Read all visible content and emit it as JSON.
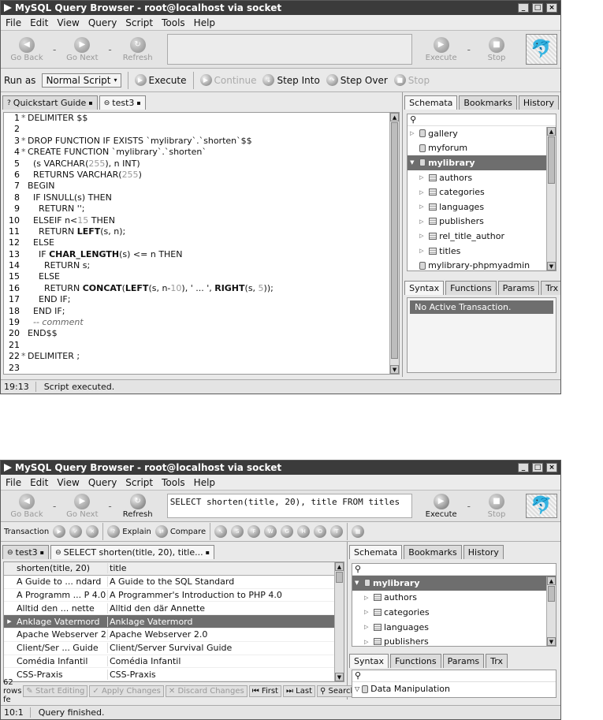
{
  "window1": {
    "title": "MySQL Query Browser - root@localhost via socket",
    "menu": [
      "File",
      "Edit",
      "View",
      "Query",
      "Script",
      "Tools",
      "Help"
    ],
    "nav": {
      "back": "Go Back",
      "next": "Go Next",
      "refresh": "Refresh"
    },
    "exec": {
      "execute": "Execute",
      "stop": "Stop"
    },
    "script_bar": {
      "run_as_label": "Run as",
      "run_as_value": "Normal Script",
      "execute": "Execute",
      "continue": "Continue",
      "step_into": "Step Into",
      "step_over": "Step Over",
      "stop": "Stop"
    },
    "tabs": [
      "Quickstart Guide",
      "test3"
    ],
    "code": [
      {
        "n": "1",
        "m": "*",
        "html": "DELIMITER $$"
      },
      {
        "n": "2",
        "m": "",
        "html": ""
      },
      {
        "n": "3",
        "m": "*",
        "html": "DROP FUNCTION IF EXISTS `mylibrary`.`shorten`$$"
      },
      {
        "n": "4",
        "m": "*",
        "html": "CREATE FUNCTION `mylibrary`.`shorten`"
      },
      {
        "n": "5",
        "m": "",
        "html": "  (s VARCHAR(<span class=\"num\">255</span>), n INT)"
      },
      {
        "n": "6",
        "m": "",
        "html": "  RETURNS VARCHAR(<span class=\"num\">255</span>)"
      },
      {
        "n": "7",
        "m": "",
        "html": "BEGIN"
      },
      {
        "n": "8",
        "m": "",
        "html": "  IF ISNULL(s) THEN"
      },
      {
        "n": "9",
        "m": "",
        "html": "    RETURN '';"
      },
      {
        "n": "10",
        "m": "",
        "html": "  ELSEIF n&lt;<span class=\"num\">15</span> THEN"
      },
      {
        "n": "11",
        "m": "",
        "html": "    RETURN <b>LEFT</b>(s, n);"
      },
      {
        "n": "12",
        "m": "",
        "html": "  ELSE"
      },
      {
        "n": "13",
        "m": "",
        "html": "    IF <b>CHAR_LENGTH</b>(s) &lt;= n THEN"
      },
      {
        "n": "14",
        "m": "",
        "html": "      RETURN s;"
      },
      {
        "n": "15",
        "m": "",
        "html": "    ELSE"
      },
      {
        "n": "16",
        "m": "",
        "html": "      RETURN <b>CONCAT</b>(<b>LEFT</b>(s, n-<span class=\"num\">10</span>), ' ... ', <b>RIGHT</b>(s, <span class=\"num\">5</span>));"
      },
      {
        "n": "17",
        "m": "",
        "html": "    END IF;"
      },
      {
        "n": "18",
        "m": "",
        "html": "  END IF;"
      },
      {
        "n": "19",
        "m": "",
        "html": "  <span class=\"cm\">-- comment</span>"
      },
      {
        "n": "20",
        "m": "",
        "html": "END$$"
      },
      {
        "n": "21",
        "m": "",
        "html": ""
      },
      {
        "n": "22",
        "m": "*",
        "html": "DELIMITER ;"
      },
      {
        "n": "23",
        "m": "",
        "html": ""
      }
    ],
    "status_pos": "19:13",
    "status_msg": "Script executed.",
    "right_tabs": [
      "Schemata",
      "Bookmarks",
      "History"
    ],
    "tree": [
      {
        "name": "gallery",
        "level": 0,
        "type": "db",
        "exp": "▷"
      },
      {
        "name": "myforum",
        "level": 0,
        "type": "db",
        "exp": ""
      },
      {
        "name": "mylibrary",
        "level": 0,
        "type": "db",
        "exp": "▼",
        "sel": true
      },
      {
        "name": "authors",
        "level": 1,
        "type": "tbl",
        "exp": "▷"
      },
      {
        "name": "categories",
        "level": 1,
        "type": "tbl",
        "exp": "▷"
      },
      {
        "name": "languages",
        "level": 1,
        "type": "tbl",
        "exp": "▷"
      },
      {
        "name": "publishers",
        "level": 1,
        "type": "tbl",
        "exp": "▷"
      },
      {
        "name": "rel_title_author",
        "level": 1,
        "type": "tbl",
        "exp": "▷"
      },
      {
        "name": "titles",
        "level": 1,
        "type": "tbl",
        "exp": "▷"
      },
      {
        "name": "mylibrary-phpmyadmin",
        "level": 0,
        "type": "db",
        "exp": ""
      }
    ],
    "lower_tabs": [
      "Syntax",
      "Functions",
      "Params",
      "Trx"
    ],
    "no_trans": "No Active Transaction."
  },
  "window2": {
    "title": "MySQL Query Browser - root@localhost via socket",
    "menu": [
      "File",
      "Edit",
      "View",
      "Query",
      "Script",
      "Tools",
      "Help"
    ],
    "nav": {
      "back": "Go Back",
      "next": "Go Next",
      "refresh": "Refresh"
    },
    "query": "SELECT shorten(title, 20), title FROM titles",
    "exec": {
      "execute": "Execute",
      "stop": "Stop"
    },
    "trans_label": "Transaction",
    "explain": "Explain",
    "compare": "Compare",
    "tabs": [
      "test3",
      "SELECT shorten(title, 20), title..."
    ],
    "grid_headers": [
      "shorten(title, 20)",
      "title"
    ],
    "grid_rows": [
      [
        "A Guide to ... ndard",
        "A Guide to the SQL Standard"
      ],
      [
        "A Programm ... P 4.0",
        "A Programmer's Introduction to PHP 4.0"
      ],
      [
        "Alltid den ... nette",
        "Alltid den där Annette"
      ],
      [
        "Anklage Vatermord",
        "Anklage Vatermord"
      ],
      [
        "Apache Webserver 2.0",
        "Apache Webserver 2.0"
      ],
      [
        "Client/Ser ... Guide",
        "Client/Server Survival Guide"
      ],
      [
        "Comédia Infantil",
        "Comédia Infantil"
      ],
      [
        "CSS-Praxis",
        "CSS-Praxis"
      ]
    ],
    "grid_selected_row": 3,
    "result_bar": {
      "count": "62 rows fe",
      "start_editing": "Start Editing",
      "apply": "Apply Changes",
      "discard": "Discard Changes",
      "first": "First",
      "last": "Last",
      "search": "Search"
    },
    "right_tabs": [
      "Schemata",
      "Bookmarks",
      "History"
    ],
    "tree": [
      {
        "name": "mylibrary",
        "level": 0,
        "type": "db",
        "exp": "▼",
        "sel": true
      },
      {
        "name": "authors",
        "level": 1,
        "type": "tbl",
        "exp": "▷"
      },
      {
        "name": "categories",
        "level": 1,
        "type": "tbl",
        "exp": "▷"
      },
      {
        "name": "languages",
        "level": 1,
        "type": "tbl",
        "exp": "▷"
      },
      {
        "name": "publishers",
        "level": 1,
        "type": "tbl",
        "exp": "▷"
      }
    ],
    "lower_tabs": [
      "Syntax",
      "Functions",
      "Params",
      "Trx"
    ],
    "syntax_item": "Data Manipulation",
    "status_pos": "10:1",
    "status_msg": "Query finished."
  }
}
